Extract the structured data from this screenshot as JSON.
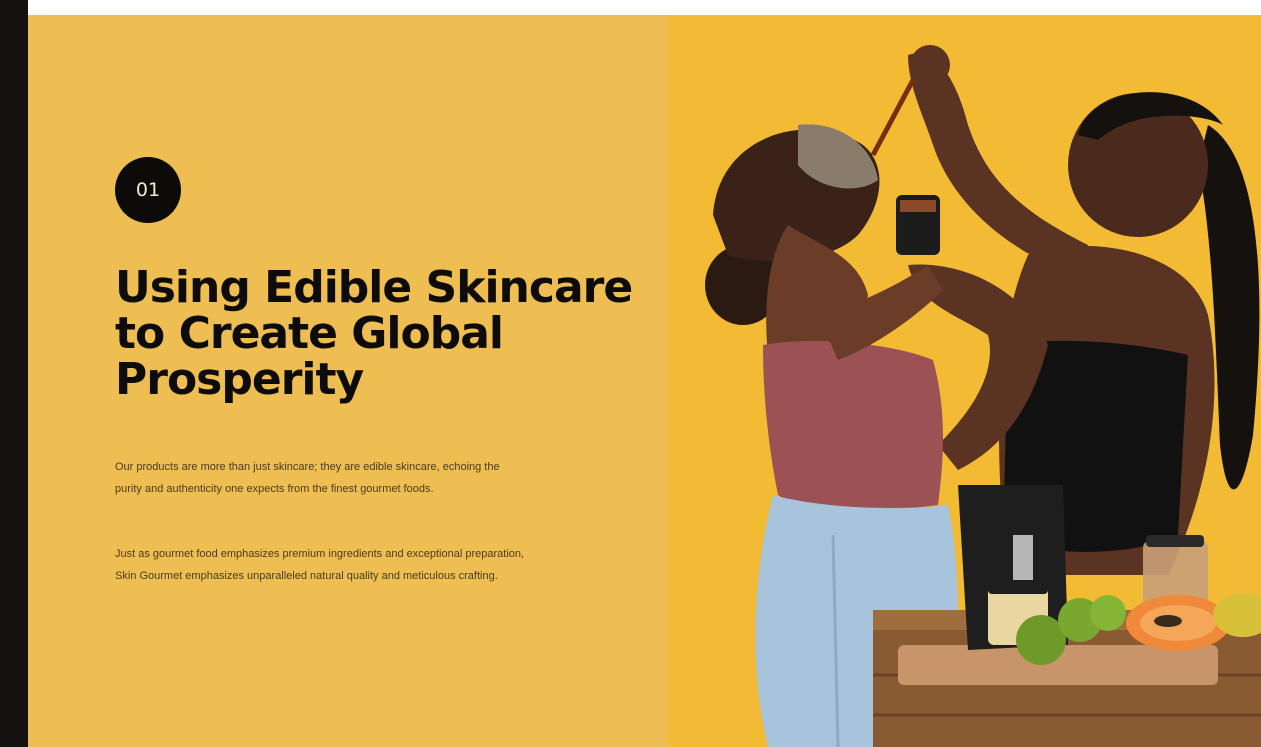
{
  "section": {
    "step_number": "01",
    "headline": "Using Edible Skincare to Create Global Prosperity",
    "paragraph_1": "Our products are more than just skincare; they are edible skincare, echoing the purity and authenticity one expects from the finest gourmet foods.",
    "paragraph_2": "Just as gourmet food emphasizes premium ingredients and exceptional preparation, Skin Gourmet emphasizes unparalleled natural quality and meticulous crafting."
  },
  "colors": {
    "panel_background": "#eebe52",
    "photo_background": "#f2b62c",
    "badge_background": "#0c0b0a",
    "headline_text": "#0d0c0a"
  }
}
